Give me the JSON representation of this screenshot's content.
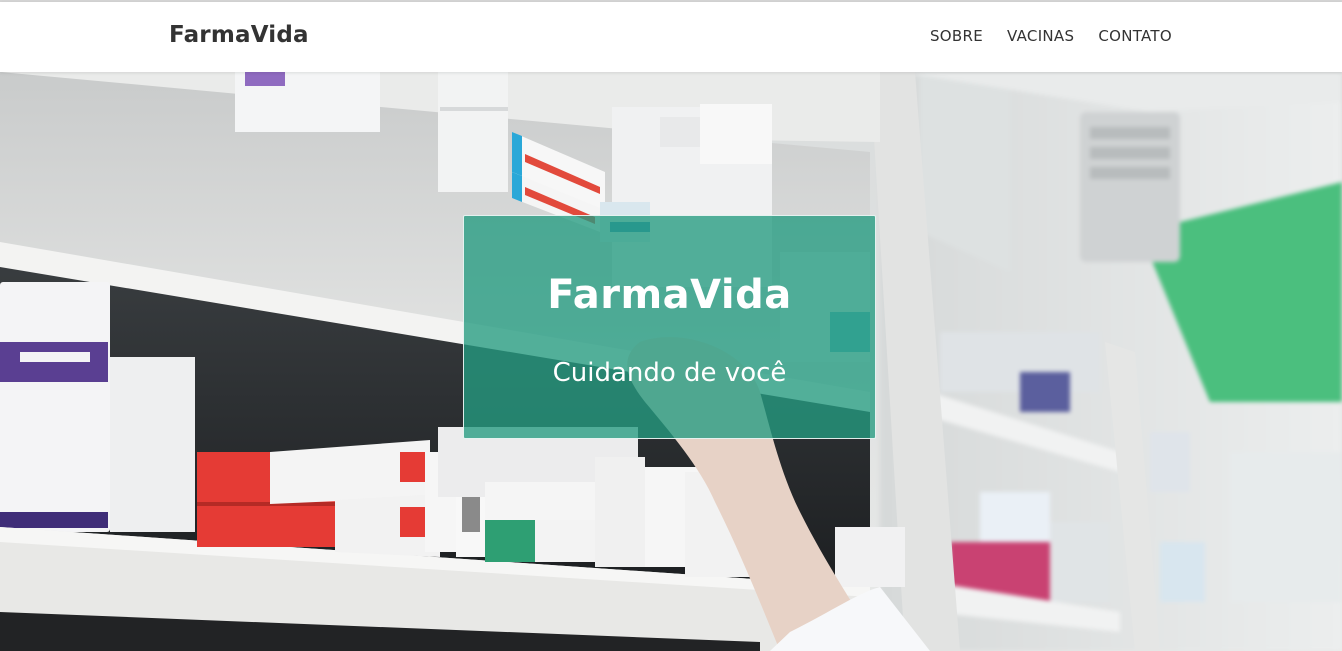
{
  "navbar": {
    "brand": "FarmaVida",
    "links": [
      {
        "label": "SOBRE"
      },
      {
        "label": "VACINAS"
      },
      {
        "label": "CONTATO"
      }
    ]
  },
  "hero": {
    "title": "FarmaVida",
    "subtitle": "Cuidando de você",
    "card_color": "#249b80",
    "background": "pharmacy-shelves-photo"
  },
  "colors": {
    "nav_text": "#333333",
    "accent_green": "#249b80",
    "wall_green": "#4bbf7e"
  }
}
